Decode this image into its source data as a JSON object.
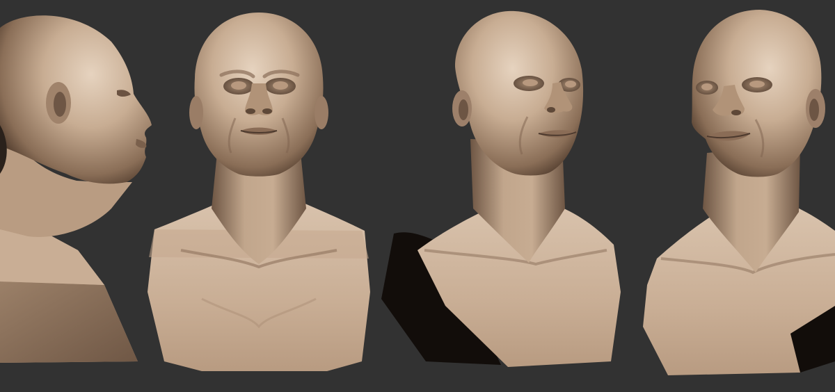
{
  "viewport": {
    "background": "#323232"
  },
  "material": {
    "base": "#c7ad94",
    "light": "#e7d5c2",
    "mid": "#a88b72",
    "dark": "#5d4839",
    "deep": "#231a14",
    "shadow_side": "#140f0c"
  },
  "views": [
    {
      "name": "side-profile-view",
      "orientation": "right-profile"
    },
    {
      "name": "front-view",
      "orientation": "front"
    },
    {
      "name": "three-quarter-view",
      "orientation": "three-quarter-right"
    },
    {
      "name": "three-quarter-left-view",
      "orientation": "three-quarter-left"
    }
  ]
}
